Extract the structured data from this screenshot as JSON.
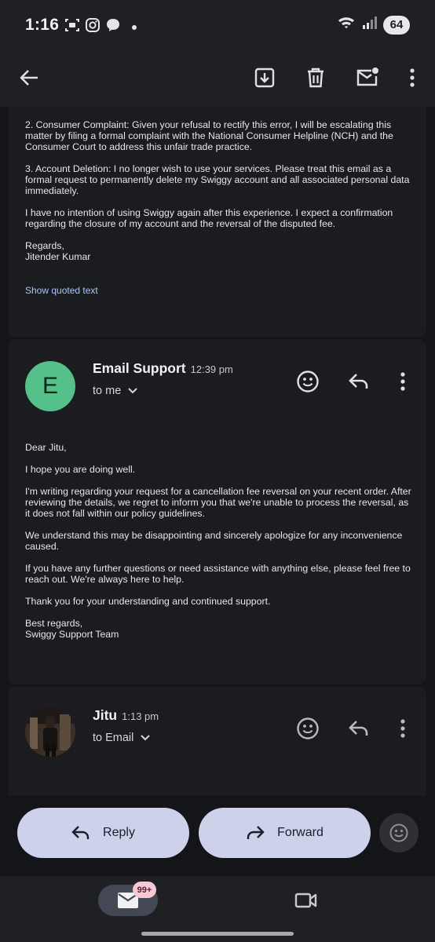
{
  "status_bar": {
    "time": "1:16",
    "battery": "64",
    "left_icons": [
      "screenshot-icon",
      "instagram-icon",
      "chat-bubble-icon",
      "dot-icon"
    ],
    "right_icons": [
      "wifi-icon",
      "signal-icon"
    ]
  },
  "toolbar": {
    "icons": [
      "back-arrow-icon",
      "archive-icon",
      "delete-icon",
      "mark-unread-icon",
      "more-vert-icon"
    ]
  },
  "message1": {
    "paragraphs": [
      "2. Consumer Complaint: Given your refusal to rectify this error, I will be escalating this matter by filing a formal complaint with the National Consumer Helpline (NCH) and the Consumer Court to address this unfair trade practice.",
      "3. Account Deletion: I no longer wish to use your services. Please treat this email as a formal request to permanently delete my Swiggy account and all associated personal data immediately.",
      "I have no intention of using Swiggy again after this experience. I expect a confirmation regarding the closure of my account and the reversal of the disputed fee."
    ],
    "regards": "Regards,",
    "signature": "Jitender Kumar",
    "show_quoted": "Show quoted text"
  },
  "message2": {
    "avatar_letter": "E",
    "sender": "Email Support",
    "time": "12:39 pm",
    "recipient": "to me",
    "greeting": "Dear Jitu,",
    "paragraphs": [
      "I hope you are doing well.",
      "I'm writing regarding your request for a cancellation fee reversal on your recent order. After reviewing the details, we regret to inform you that we're unable to process the reversal, as it does not fall within our policy guidelines.",
      "We understand this may be disappointing and sincerely apologize for any inconvenience caused.",
      "If you have any further questions or need assistance with anything else, please feel free to reach out. We're always here to help.",
      "Thank you for your understanding and continued support."
    ],
    "closing": "Best regards,",
    "team": "Swiggy Support Team"
  },
  "message3": {
    "sender": "Jitu",
    "time": "1:13 pm",
    "recipient": "to Email"
  },
  "actions": {
    "reply": "Reply",
    "forward": "Forward"
  },
  "bottom_nav": {
    "mail_badge": "99+"
  },
  "colors": {
    "avatar_e": "#56c08a",
    "pill_buttons": "#cdd1ea",
    "link": "#a8c7fa"
  }
}
